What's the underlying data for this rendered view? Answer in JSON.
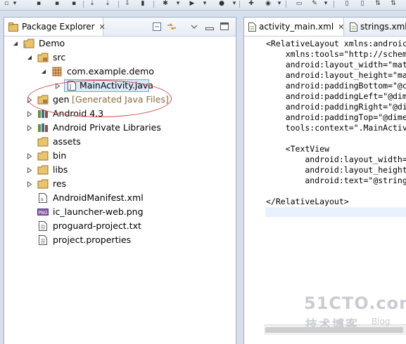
{
  "explorer": {
    "tab_label": "Package Explorer",
    "close_symbol": "✕",
    "tree": [
      {
        "label": "Demo",
        "icon": "project-folder-icon",
        "twisty": "expanded"
      },
      {
        "label": "src",
        "icon": "source-folder-icon",
        "twisty": "expanded"
      },
      {
        "label": "com.example.demo",
        "icon": "package-icon",
        "twisty": "expanded"
      },
      {
        "label": "MainActivity.java",
        "icon": "java-file-icon",
        "twisty": "collapsed",
        "selected": true
      },
      {
        "label": "gen",
        "decoration": "[Generated Java Files]",
        "icon": "source-folder-icon",
        "twisty": "collapsed"
      },
      {
        "label": "Android 4.3",
        "icon": "library-icon",
        "twisty": "collapsed"
      },
      {
        "label": "Android Private Libraries",
        "icon": "library-icon",
        "twisty": "collapsed"
      },
      {
        "label": "assets",
        "icon": "folder-icon",
        "twisty": "none"
      },
      {
        "label": "bin",
        "icon": "folder-icon",
        "twisty": "collapsed"
      },
      {
        "label": "libs",
        "icon": "folder-icon",
        "twisty": "collapsed"
      },
      {
        "label": "res",
        "icon": "folder-icon",
        "twisty": "collapsed"
      },
      {
        "label": "AndroidManifest.xml",
        "icon": "xml-file-icon",
        "twisty": "none"
      },
      {
        "label": "ic_launcher-web.png",
        "icon": "png-file-icon",
        "twisty": "none"
      },
      {
        "label": "proguard-project.txt",
        "icon": "text-file-icon",
        "twisty": "none"
      },
      {
        "label": "project.properties",
        "icon": "text-file-icon",
        "twisty": "none"
      }
    ]
  },
  "editor": {
    "tabs": [
      {
        "label": "activity_main.xml",
        "active": true
      },
      {
        "label": "strings.xml",
        "active": false
      }
    ],
    "code_lines": [
      "<RelativeLayout xmlns:androic",
      "    xmlns:tools=\"http://schem",
      "    android:layout_width=\"mat",
      "    android:layout_height=\"ma",
      "    android:paddingBottom=\"@c",
      "    android:paddingLeft=\"@dim",
      "    android:paddingRight=\"@di",
      "    android:paddingTop=\"@dime",
      "    tools:context=\".MainActiv",
      "",
      "    <TextView",
      "        android:layout_width=",
      "        android:layout_height",
      "        android:text=\"@string",
      "",
      "</RelativeLayout>"
    ]
  },
  "watermark": {
    "brand": "51CTO.com",
    "tagline": "技术博客",
    "blog": "Blog"
  },
  "colors": {
    "annotation": "#d74a4a",
    "selection": "#dce9f8",
    "decoration": "#8a6d3b"
  }
}
